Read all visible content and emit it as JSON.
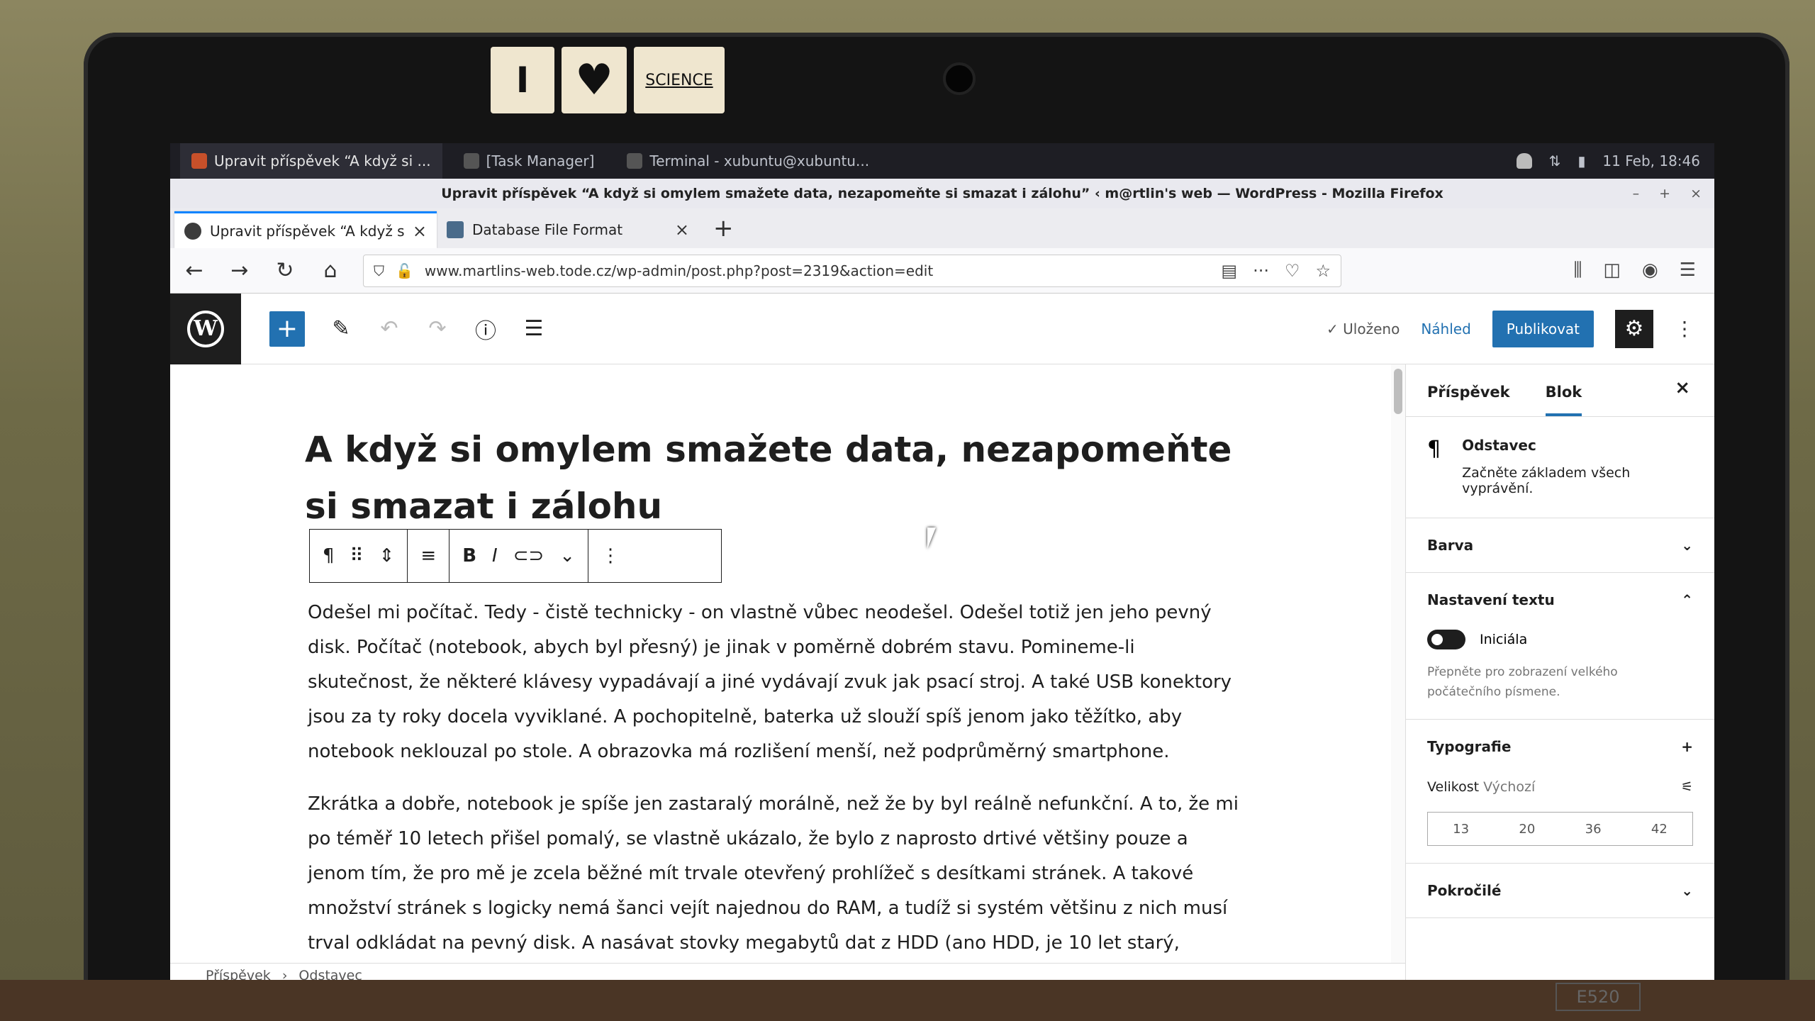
{
  "stickers": {
    "s1": "I",
    "s2": "♥",
    "s3": "SCIENCE"
  },
  "os": {
    "tasks": [
      {
        "label": "Upravit příspěvek “A když si ..."
      },
      {
        "label": "[Task Manager]"
      },
      {
        "label": "Terminal - xubuntu@xubuntu..."
      }
    ],
    "clock": "11 Feb, 18:46"
  },
  "browser": {
    "window_title": "Upravit příspěvek “A když si omylem smažete data, nezapomeňte si smazat i zálohu” ‹ m@rtlin's web — WordPress - Mozilla Firefox",
    "tabs": [
      {
        "label": "Upravit příspěvek “A když si o"
      },
      {
        "label": "Database File Format"
      }
    ],
    "url": "www.martlins-web.tode.cz/wp-admin/post.php?post=2319&action=edit"
  },
  "editor": {
    "saved": "✓ Uloženo",
    "preview": "Náhled",
    "publish": "Publikovat",
    "title": "A když si omylem smažete data, nezapomeňte si smazat i zálohu",
    "paragraph1": "Odešel mi počítač. Tedy - čistě technicky - on vlastně vůbec neodešel. Odešel totiž jen jeho pevný disk. Počítač (notebook, abych byl přesný) je jinak v poměrně dobrém stavu. Pomineme-li skutečnost, že některé klávesy vypadávají a jiné vydávají zvuk jak psací stroj. A také USB konektory jsou za ty roky docela vyviklané. A pochopitelně, baterka už slouží spíš jenom jako těžítko, aby notebook neklouzal po stole. A obrazovka má rozlišení menší, než podprůměrný smartphone.",
    "paragraph2": "Zkrátka a dobře, notebook je spíše jen zastaralý morálně, než že by byl reálně nefunkční. A to, že mi po téměř 10 letech přišel pomalý, se vlastně ukázalo, že bylo z naprosto drtivé většiny pouze a jenom tím, že pro mě je zcela běžné mít trvale otevřený prohlížeč s desítkami stránek. A takové množství stránek s logicky nemá šanci vejít najednou do RAM, a tudíž si systém většinu z nich musí trval odkládat na pevný disk. A nasávat stovky megabytů dat z HDD (ano HDD, je 10 let starý, vzpomínáte?) při každém přepnutí",
    "breadcrumb": [
      "Příspěvek",
      "Odstavec"
    ]
  },
  "sidebar": {
    "tab_post": "Příspěvek",
    "tab_block": "Blok",
    "block_name": "Odstavec",
    "block_desc": "Začněte základem všech vyprávění.",
    "panel_color": "Barva",
    "panel_text": "Nastavení textu",
    "dropcap_label": "Iniciála",
    "dropcap_help": "Přepněte pro zobrazení velkého počátečního písmene.",
    "panel_typo": "Typografie",
    "size_label": "Velikost",
    "size_default": "Výchozí",
    "sizes": [
      "13",
      "20",
      "36",
      "42"
    ],
    "panel_advanced": "Pokročilé"
  },
  "laptop_model": "E520"
}
